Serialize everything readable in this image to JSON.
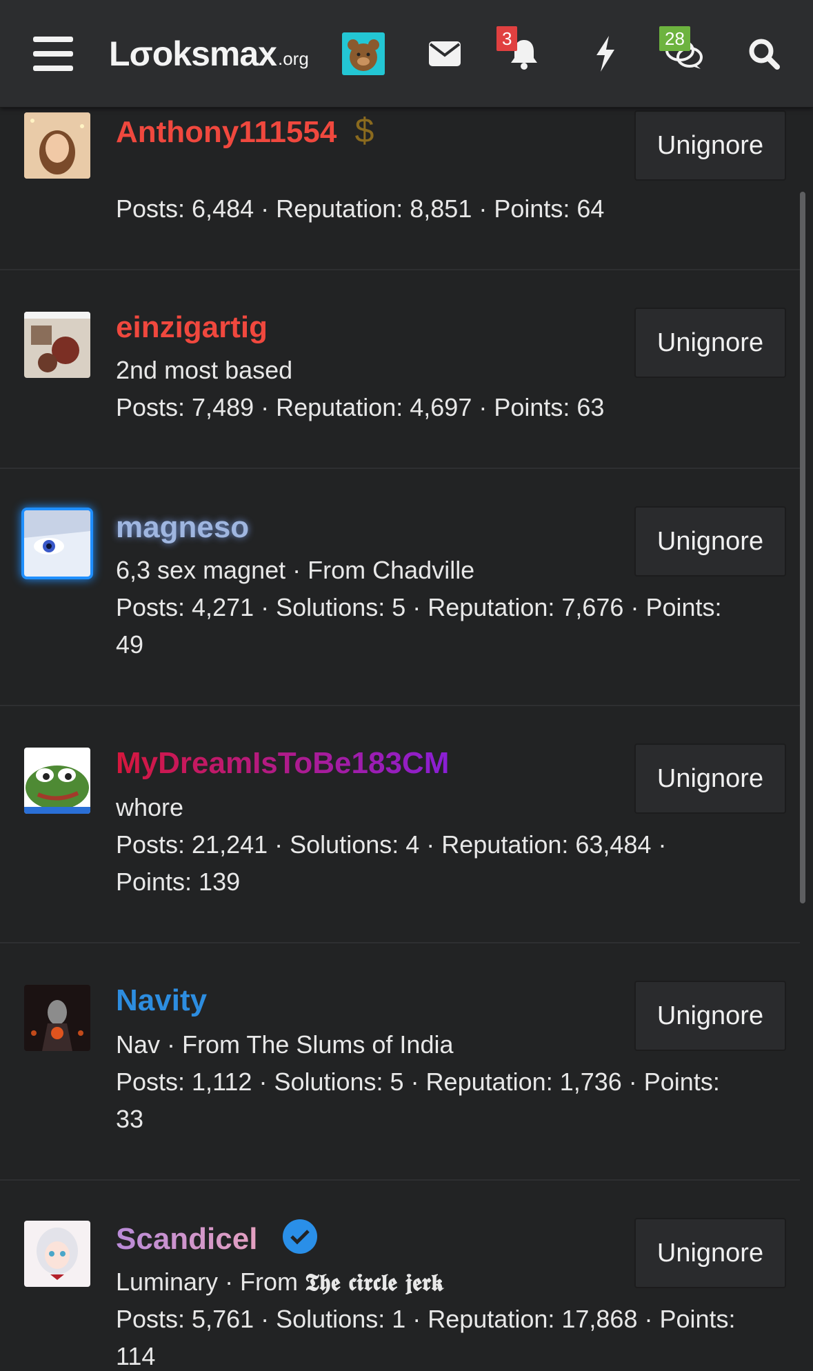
{
  "header": {
    "logo_text": "Lσoksmax",
    "logo_suffix": ".org",
    "notifications_badge": "3",
    "conversations_badge": "28",
    "colors": {
      "bar": "#2c2d2f",
      "notif_badge": "#e04040",
      "conv_badge": "#6db33f"
    }
  },
  "rows": [
    {
      "name": "Anthony111554",
      "name_color": "#f0483e",
      "name_extra": "$",
      "subtitle": "",
      "stats": "Posts: 6,484 · Reputation: 8,851 · Points: 64",
      "stats2": "",
      "button": "Unignore"
    },
    {
      "name": "einzigartig",
      "name_color": "#f0483e",
      "name_extra": "",
      "subtitle": "2nd most based",
      "stats": "Posts: 7,489 · Reputation: 4,697 · Points: 63",
      "stats2": "",
      "button": "Unignore"
    },
    {
      "name": "magneso",
      "name_color": "#9fb6e0",
      "name_extra": "",
      "subtitle": "6,3 sex magnet · From Chadville",
      "stats": "Posts: 4,271 · Solutions: 5 · Reputation: 7,676 · Points:",
      "stats2": "49",
      "button": "Unignore"
    },
    {
      "name": "MyDreamIsToBe183CM",
      "name_color": "#c4176e",
      "name_extra": "",
      "subtitle": "whore",
      "stats": "Posts: 21,241 · Solutions: 4 · Reputation: 63,484 ·",
      "stats2": "Points: 139",
      "button": "Unignore"
    },
    {
      "name": "Navity",
      "name_color": "#2d8de0",
      "name_extra": "",
      "subtitle": "Nav · From The Slums of India",
      "stats": "Posts: 1,112 · Solutions: 5 · Reputation: 1,736 · Points:",
      "stats2": "33",
      "button": "Unignore"
    },
    {
      "name": "Scandicel",
      "name_color": "#c08ad8",
      "name_extra": "",
      "subtitle_prefix": "Luminary · From ",
      "subtitle_fancy": "𝕿𝖍𝖊 𝖈𝖎𝖗𝖈𝖑𝖊 𝖏𝖊𝖗𝖐",
      "stats": "Posts: 5,761 · Solutions: 1 · Reputation: 17,868 · Points:",
      "stats2": "114",
      "button": "Unignore"
    }
  ]
}
